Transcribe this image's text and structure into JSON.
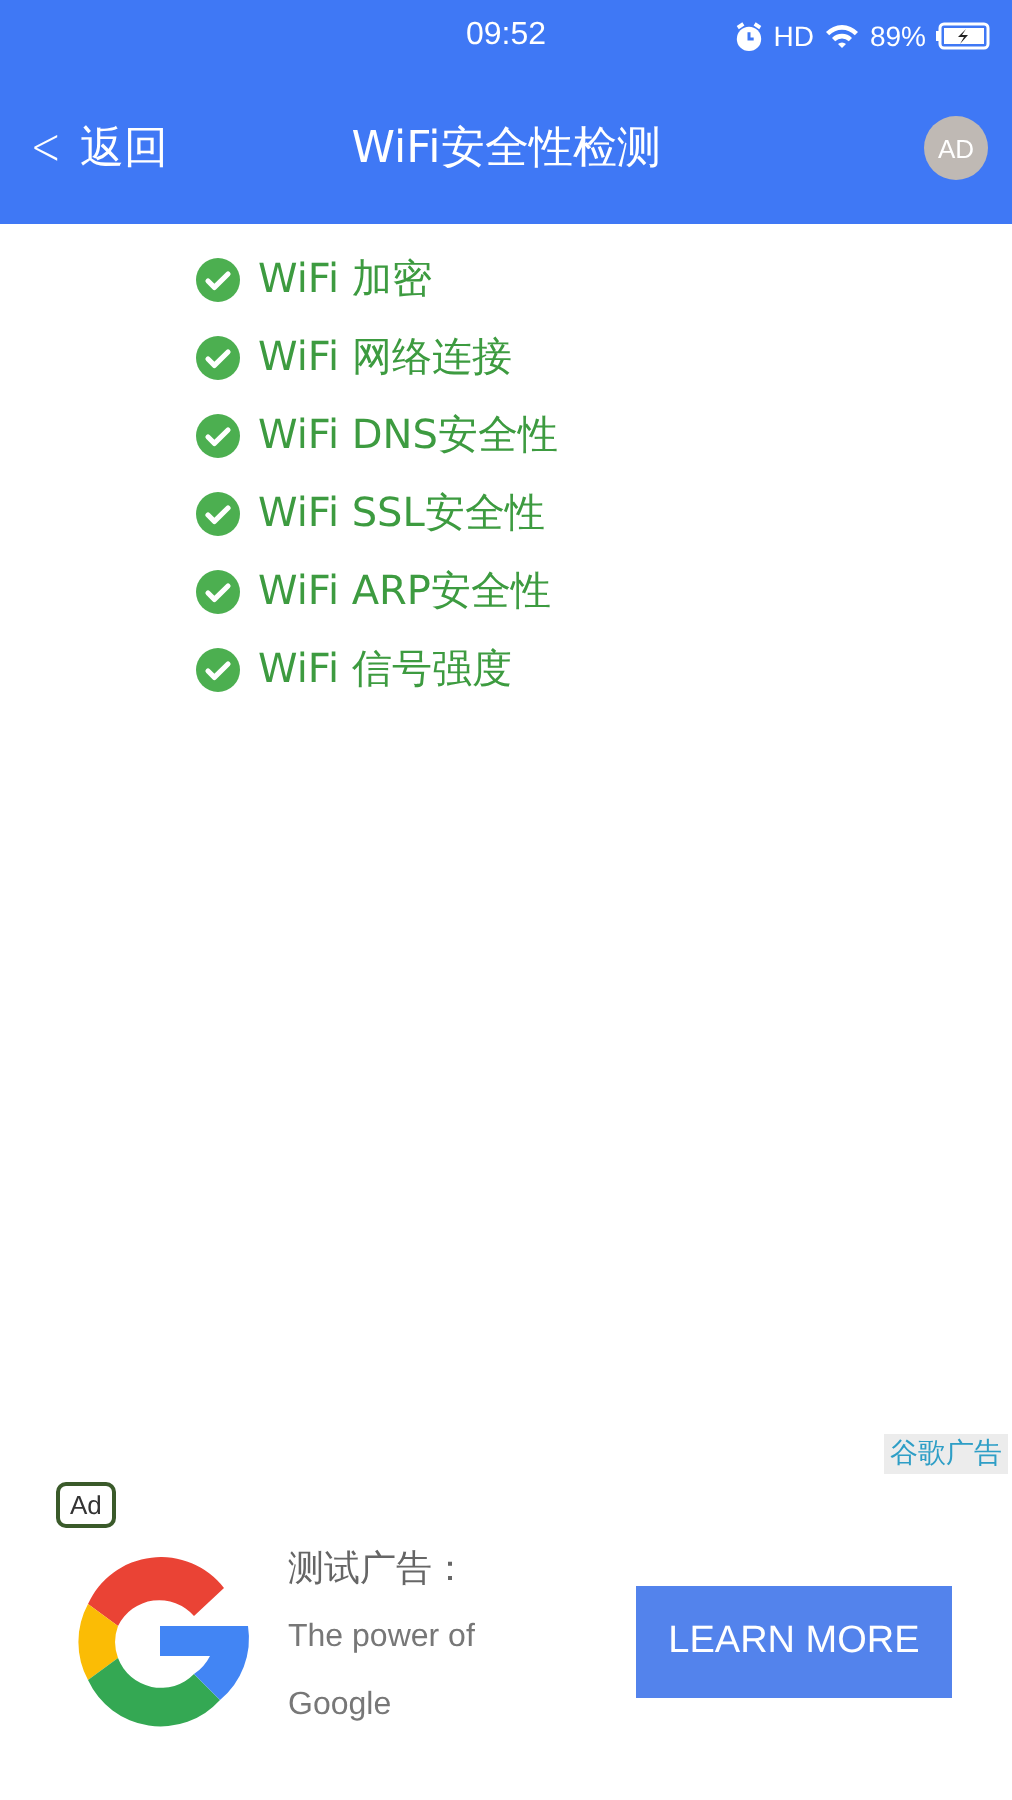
{
  "status_bar": {
    "time": "09:52",
    "network": "HD",
    "battery": "89%"
  },
  "header": {
    "back": "<",
    "back_label": "返回",
    "title": "WiFi安全性检测",
    "ad_badge": "AD"
  },
  "checks": [
    {
      "label": "WiFi 加密",
      "checked": true
    },
    {
      "label": "WiFi 网络连接",
      "checked": true
    },
    {
      "label": "WiFi DNS安全性",
      "checked": true
    },
    {
      "label": "WiFi SSL安全性",
      "checked": true
    },
    {
      "label": "WiFi ARP安全性",
      "checked": true
    },
    {
      "label": "WiFi 信号强度",
      "checked": true
    }
  ],
  "ad": {
    "source": "谷歌广告",
    "badge": "Ad",
    "title": "测试广告：",
    "body": "The power of Google",
    "button": "LEARN MORE"
  }
}
